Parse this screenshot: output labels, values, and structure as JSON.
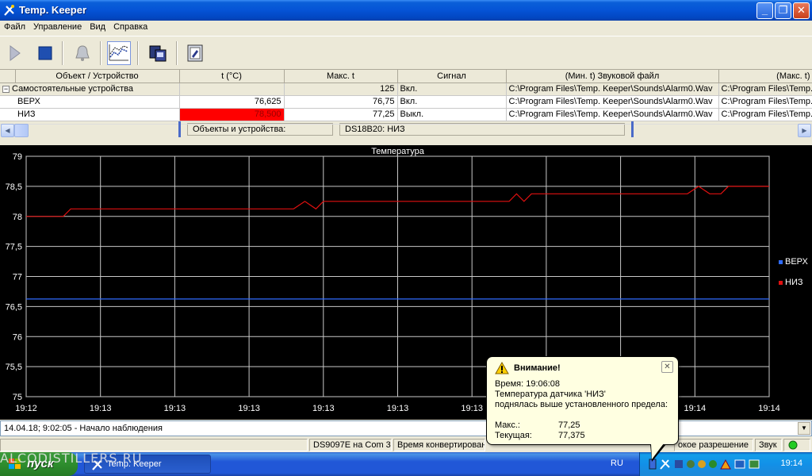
{
  "window": {
    "title": "Temp. Keeper"
  },
  "menu": [
    "Файл",
    "Управление",
    "Вид",
    "Справка"
  ],
  "toolbar": [
    {
      "icon": "play-icon"
    },
    {
      "icon": "stop-icon"
    },
    {
      "icon": "bell-icon"
    },
    {
      "icon": "chart-icon"
    },
    {
      "icon": "devices-icon"
    },
    {
      "icon": "settings-icon"
    }
  ],
  "grid": {
    "headers": [
      "Объект / Устройство",
      "t (°C)",
      "Макс. t",
      "Сигнал",
      "(Мин. t) Звуковой файл",
      "(Макс. t)"
    ],
    "rows": [
      {
        "name": "Самостоятельные устройства",
        "t": "",
        "max": "125",
        "signal": "Вкл.",
        "file_min": "C:\\Program Files\\Temp. Keeper\\Sounds\\Alarm0.Wav",
        "file_max": "C:\\Program Files\\Temp."
      },
      {
        "name": "ВЕРХ",
        "t": "76,625",
        "max": "76,75",
        "signal": "Вкл.",
        "file_min": "C:\\Program Files\\Temp. Keeper\\Sounds\\Alarm0.Wav",
        "file_max": "C:\\Program Files\\Temp."
      },
      {
        "name": "НИЗ",
        "t": "78,500",
        "max": "77,25",
        "signal": "Выкл.",
        "file_min": "C:\\Program Files\\Temp. Keeper\\Sounds\\Alarm0.Wav",
        "file_max": "C:\\Program Files\\Temp."
      }
    ]
  },
  "panels": {
    "objects": "Объекты и устройства:",
    "sensor": "DS18B20: НИЗ"
  },
  "chart_data": {
    "type": "line",
    "title": "Температура",
    "ylim": [
      75,
      79
    ],
    "yticks": [
      "75",
      "75,5",
      "76",
      "76,5",
      "77",
      "77,5",
      "78",
      "78,5",
      "79"
    ],
    "xticks": [
      "19:12",
      "19:13",
      "19:13",
      "19:13",
      "19:13",
      "19:13",
      "19:13",
      "19:14",
      "19:14",
      "19:14",
      "19:14"
    ],
    "xlim": [
      0,
      10
    ],
    "grid": true,
    "legend_position": "right",
    "series": [
      {
        "name": "ВЕРХ",
        "color": "#2f6bff",
        "x": [
          0,
          10
        ],
        "y": [
          76.625,
          76.625
        ]
      },
      {
        "name": "НИЗ",
        "color": "#e01010",
        "x": [
          0,
          0.5,
          0.6,
          3.6,
          3.75,
          3.9,
          4.0,
          6.5,
          6.6,
          6.7,
          6.8,
          8.9,
          9.05,
          9.2,
          9.35,
          9.45,
          10
        ],
        "y": [
          78.0,
          78.0,
          78.125,
          78.125,
          78.25,
          78.125,
          78.25,
          78.25,
          78.375,
          78.25,
          78.375,
          78.375,
          78.5,
          78.375,
          78.375,
          78.5,
          78.5
        ]
      }
    ]
  },
  "log": {
    "text": "14.04.18; 9:02:05 - Начало наблюдения"
  },
  "status": [
    "DS9097E на Com 3",
    "Время конвертирования",
    "окое разрешение",
    "Звук"
  ],
  "balloon": {
    "title": "Внимание!",
    "time_line": "Время: 19:06:08",
    "message1": "Температура датчика 'НИЗ'",
    "message2": "поднялась выше установленного предела:",
    "max_label": "Макс.:",
    "max_value": "77,25",
    "current_label": "Текущая:",
    "current_value": "77,375"
  },
  "taskbar": {
    "start": "пуск",
    "task": "Temp. Keeper",
    "lang": "RU",
    "clock": "19:14"
  },
  "watermark": "ALCODISTILLERS.RU"
}
